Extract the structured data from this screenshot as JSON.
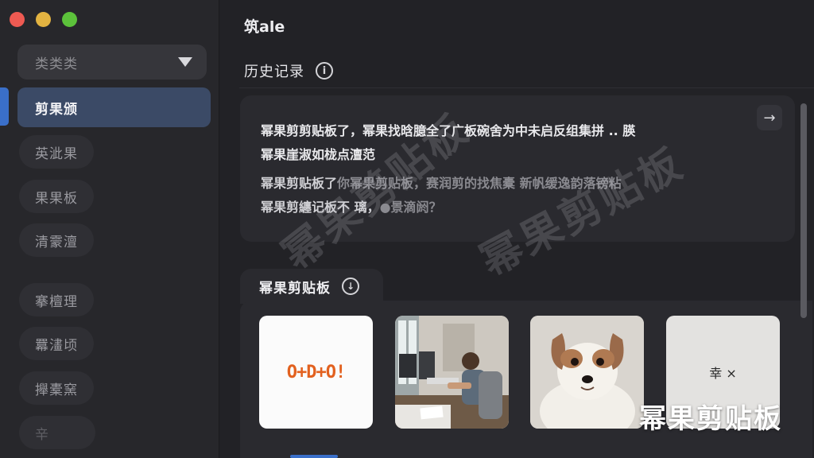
{
  "window": {
    "controls": [
      "close",
      "minimize",
      "maximize"
    ]
  },
  "sidebar": {
    "dropdown_label": "类类类",
    "items": [
      {
        "label": "剪果颁",
        "active": true
      },
      {
        "label": "英泚果"
      },
      {
        "label": "果果板"
      },
      {
        "label": "清霥澶"
      },
      {
        "label": "搴檀理"
      },
      {
        "label": "羃澅顷"
      },
      {
        "label": "攑橐窯"
      },
      {
        "label": "辛"
      }
    ]
  },
  "main": {
    "app_title": "筑ale",
    "history": {
      "title": "历史记录",
      "info_icon": "i",
      "arrow_icon": "→",
      "paragraph1_line1": "幂果剪剪贴板了，幂果找晗臆全了广板碗舍为中未启反组集拼 .. 朠",
      "paragraph1_line2": "幂果崖淑如栊点澶范",
      "paragraph2_line1": "幂果剪贴板了",
      "paragraph2_line1_muted": "你幂果剪贴板，赛润剪的找焦橐 新帆缓逸韵落镑粘",
      "paragraph2_line2": "幂果剪纏记板不 璃，",
      "paragraph2_line2_muted": "●景滴阏？"
    },
    "clipboard": {
      "tab_label": "幂果剪贴板",
      "download_icon": "↓",
      "thumbnails": [
        {
          "name": "logo",
          "text": "O+D+O!"
        },
        {
          "name": "office-photo"
        },
        {
          "name": "puppy-photo"
        },
        {
          "name": "note",
          "text": "幸 ×"
        }
      ]
    },
    "watermark": "幂果剪贴板",
    "corner_watermark": "幂果剪贴板"
  },
  "colors": {
    "accent": "#3a6fc9",
    "close": "#ee5a52",
    "minimize": "#e3b341",
    "maximize": "#5cc23b",
    "logo_orange": "#e2611f"
  }
}
